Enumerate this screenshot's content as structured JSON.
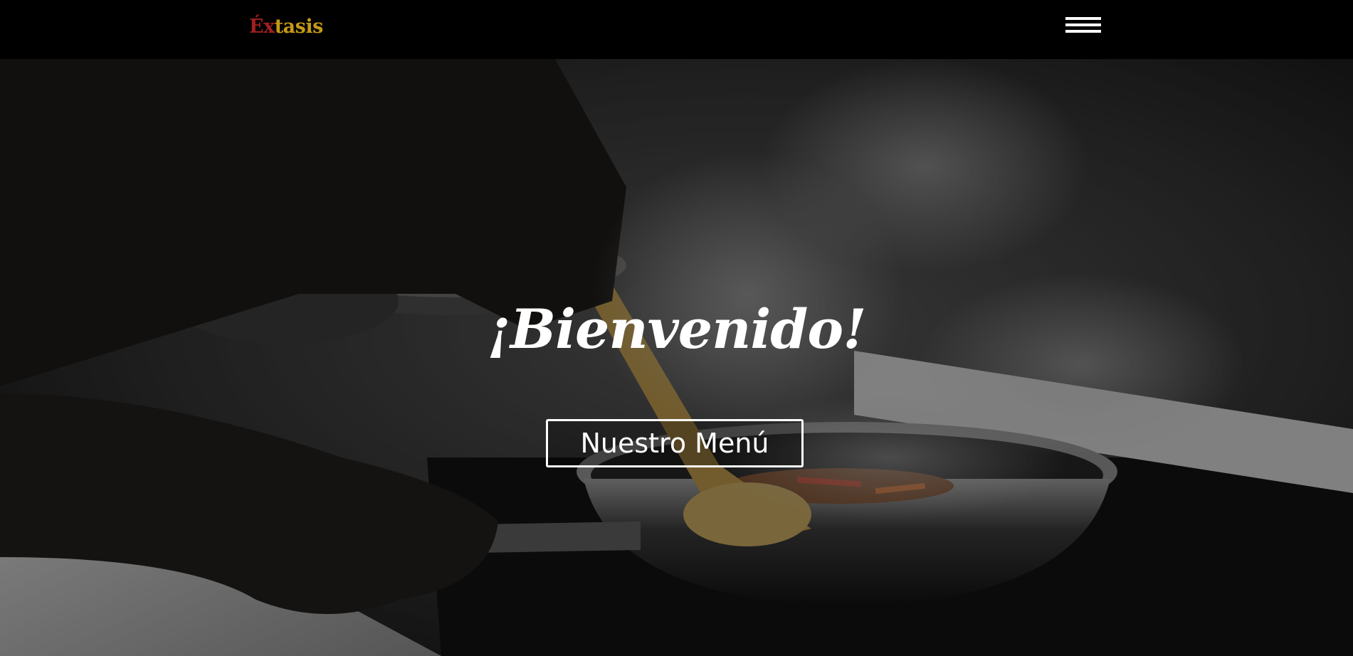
{
  "navbar": {
    "logo_accent": "Éx",
    "logo_rest": "tasis"
  },
  "hero": {
    "title": "¡Bienvenido!",
    "button_label": "Nuestro Menú"
  },
  "colors": {
    "logo_red": "#a31f1f",
    "logo_gold": "#c49a16",
    "navbar_bg": "#000000"
  },
  "icons": {
    "menu": "hamburger-icon"
  }
}
